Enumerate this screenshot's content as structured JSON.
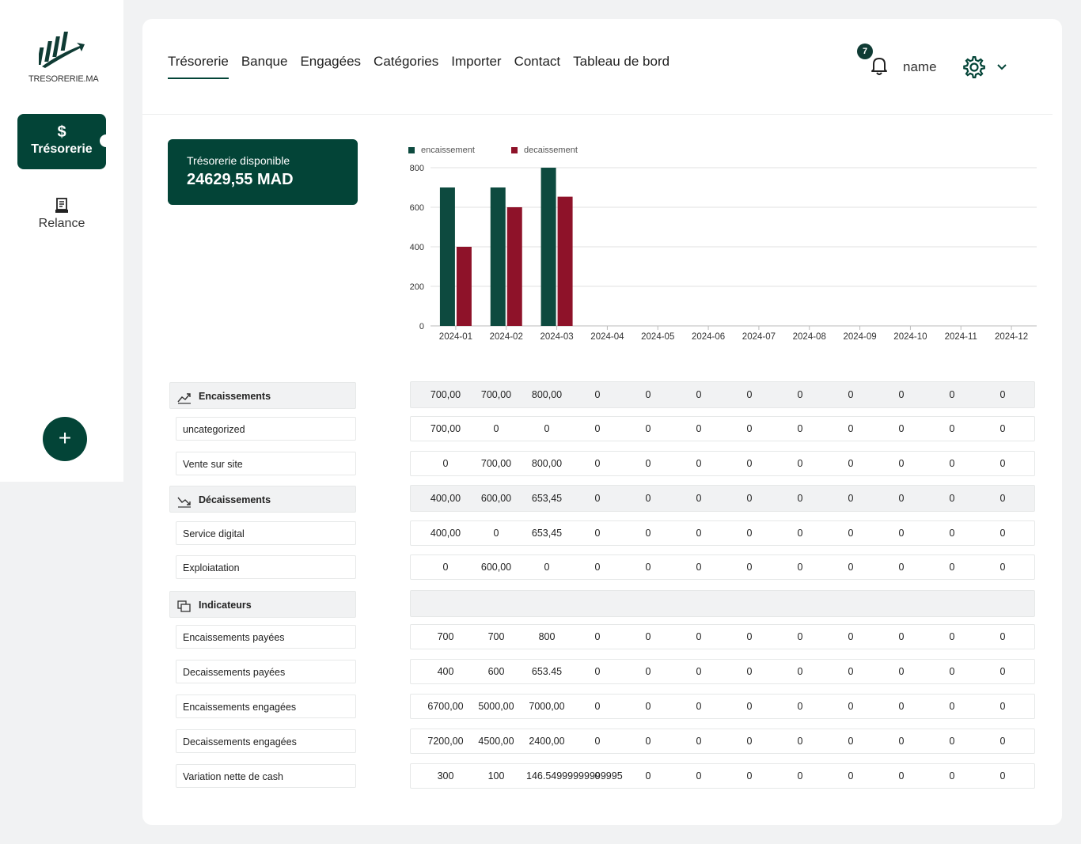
{
  "brand": {
    "name": "TRESORERIE.MA"
  },
  "colors": {
    "primary": "#034437",
    "encaissement": "#0d4a3f",
    "decaissement": "#8e1229",
    "background": "#f1f2f3"
  },
  "sidebar": {
    "items": [
      {
        "label": "Trésorerie",
        "icon": "dollar-icon",
        "active": true
      },
      {
        "label": "Relance",
        "icon": "receipt-icon",
        "active": false
      }
    ],
    "fab_icon": "plus-icon"
  },
  "topnav": {
    "tabs": [
      "Trésorerie",
      "Banque",
      "Engagées",
      "Catégories",
      "Importer",
      "Contact",
      "Tableau de bord"
    ],
    "active_tab": "Trésorerie"
  },
  "header": {
    "notification_count": "7",
    "username": "name"
  },
  "balance": {
    "title": "Trésorerie disponible",
    "value": "24629,55 MAD"
  },
  "chart_data": {
    "type": "bar",
    "categories": [
      "2024-01",
      "2024-02",
      "2024-03",
      "2024-04",
      "2024-05",
      "2024-06",
      "2024-07",
      "2024-08",
      "2024-09",
      "2024-10",
      "2024-11",
      "2024-12"
    ],
    "series": [
      {
        "name": "encaissement",
        "values": [
          700,
          700,
          800,
          0,
          0,
          0,
          0,
          0,
          0,
          0,
          0,
          0
        ]
      },
      {
        "name": "decaissement",
        "values": [
          400,
          600,
          653.45,
          0,
          0,
          0,
          0,
          0,
          0,
          0,
          0,
          0
        ]
      }
    ],
    "ylim": [
      0,
      800
    ],
    "yticks": [
      0,
      200,
      400,
      600,
      800
    ],
    "legend": "top-left",
    "grid": true
  },
  "table": {
    "rows": [
      {
        "label": "Encaissements",
        "section": true,
        "icon": "trending-up-icon",
        "values": [
          "700,00",
          "700,00",
          "800,00",
          "0",
          "0",
          "0",
          "0",
          "0",
          "0",
          "0",
          "0",
          "0"
        ]
      },
      {
        "label": "uncategorized",
        "values": [
          "700,00",
          "0",
          "0",
          "0",
          "0",
          "0",
          "0",
          "0",
          "0",
          "0",
          "0",
          "0"
        ]
      },
      {
        "label": "Vente sur site",
        "values": [
          "0",
          "700,00",
          "800,00",
          "0",
          "0",
          "0",
          "0",
          "0",
          "0",
          "0",
          "0",
          "0"
        ]
      },
      {
        "label": "Décaissements",
        "section": true,
        "icon": "trending-down-icon",
        "values": [
          "400,00",
          "600,00",
          "653,45",
          "0",
          "0",
          "0",
          "0",
          "0",
          "0",
          "0",
          "0",
          "0"
        ]
      },
      {
        "label": "Service digital",
        "values": [
          "400,00",
          "0",
          "653,45",
          "0",
          "0",
          "0",
          "0",
          "0",
          "0",
          "0",
          "0",
          "0"
        ]
      },
      {
        "label": "Exploiatation",
        "values": [
          "0",
          "600,00",
          "0",
          "0",
          "0",
          "0",
          "0",
          "0",
          "0",
          "0",
          "0",
          "0"
        ]
      },
      {
        "label": "Indicateurs",
        "section": true,
        "icon": "copy-icon",
        "values": []
      },
      {
        "label": "Encaissements payées",
        "values": [
          "700",
          "700",
          "800",
          "0",
          "0",
          "0",
          "0",
          "0",
          "0",
          "0",
          "0",
          "0"
        ]
      },
      {
        "label": "Decaissements payées",
        "values": [
          "400",
          "600",
          "653.45",
          "0",
          "0",
          "0",
          "0",
          "0",
          "0",
          "0",
          "0",
          "0"
        ]
      },
      {
        "label": "Encaissements engagées",
        "values": [
          "6700,00",
          "5000,00",
          "7000,00",
          "0",
          "0",
          "0",
          "0",
          "0",
          "0",
          "0",
          "0",
          "0"
        ]
      },
      {
        "label": "Decaissements engagées",
        "values": [
          "7200,00",
          "4500,00",
          "2400,00",
          "0",
          "0",
          "0",
          "0",
          "0",
          "0",
          "0",
          "0",
          "0"
        ]
      },
      {
        "label": "Variation nette de cash",
        "values": [
          "300",
          "100",
          "146.54999999999995",
          "0",
          "0",
          "0",
          "0",
          "0",
          "0",
          "0",
          "0",
          "0"
        ]
      }
    ]
  }
}
